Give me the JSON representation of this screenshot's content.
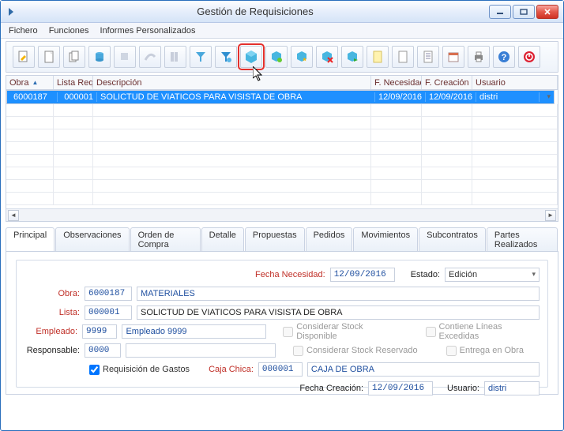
{
  "window": {
    "title": "Gestión de Requisiciones"
  },
  "menu": {
    "fichero": "Fichero",
    "funciones": "Funciones",
    "informes": "Informes Personalizados"
  },
  "toolbar": {
    "icons": [
      "edit-pencil",
      "new-page",
      "copy",
      "db-cylinder",
      "puzzle",
      "swoosh",
      "series",
      "filter",
      "filter-blue",
      "cube-highlight",
      "cube-add",
      "cube-star",
      "cube-x",
      "cube-arrow",
      "page-yellow",
      "page-white",
      "page-lines",
      "calendar",
      "printer",
      "help",
      "power"
    ]
  },
  "grid": {
    "headers": {
      "obra": "Obra",
      "lista": "Lista Req.",
      "desc": "Descripción",
      "nec": "F. Necesidad",
      "crea": "F. Creación",
      "usr": "Usuario"
    },
    "rows": [
      {
        "obra": "6000187",
        "lista": "000001",
        "desc": "SOLICTUD DE VIATICOS PARA VISISTA DE OBRA",
        "nec": "12/09/2016",
        "crea": "12/09/2016",
        "usr": "distri"
      }
    ]
  },
  "tabs": {
    "principal": "Principal",
    "observaciones": "Observaciones",
    "orden": "Orden de Compra",
    "detalle": "Detalle",
    "propuestas": "Propuestas",
    "pedidos": "Pedidos",
    "movimientos": "Movimientos",
    "subcontratos": "Subcontratos",
    "partes": "Partes Realizados"
  },
  "form": {
    "fechaNecLabel": "Fecha Necesidad:",
    "fechaNec": "12/09/2016",
    "estadoLabel": "Estado:",
    "estado": "Edición",
    "obraLabel": "Obra:",
    "obraCode": "6000187",
    "obraName": "MATERIALES",
    "listaLabel": "Lista:",
    "listaCode": "000001",
    "listaName": "SOLICTUD DE VIATICOS PARA VISISTA DE OBRA",
    "empleadoLabel": "Empleado:",
    "empleadoCode": "9999",
    "empleadoName": "Empleado 9999",
    "respLabel": "Responsable:",
    "respCode": "0000",
    "chkStockDisp": "Considerar Stock Disponible",
    "chkLineasExc": "Contiene Líneas Excedidas",
    "chkStockRes": "Considerar Stock Reservado",
    "chkEntrega": "Entrega en Obra",
    "chkReqGastos": "Requisición de Gastos",
    "cajaChicaLabel": "Caja Chica:",
    "cajaChicaCode": "000001",
    "cajaChicaName": "CAJA DE OBRA",
    "fechaCreaLabel": "Fecha Creación:",
    "fechaCrea": "12/09/2016",
    "usuarioLabel": "Usuario:",
    "usuario": "distri"
  }
}
